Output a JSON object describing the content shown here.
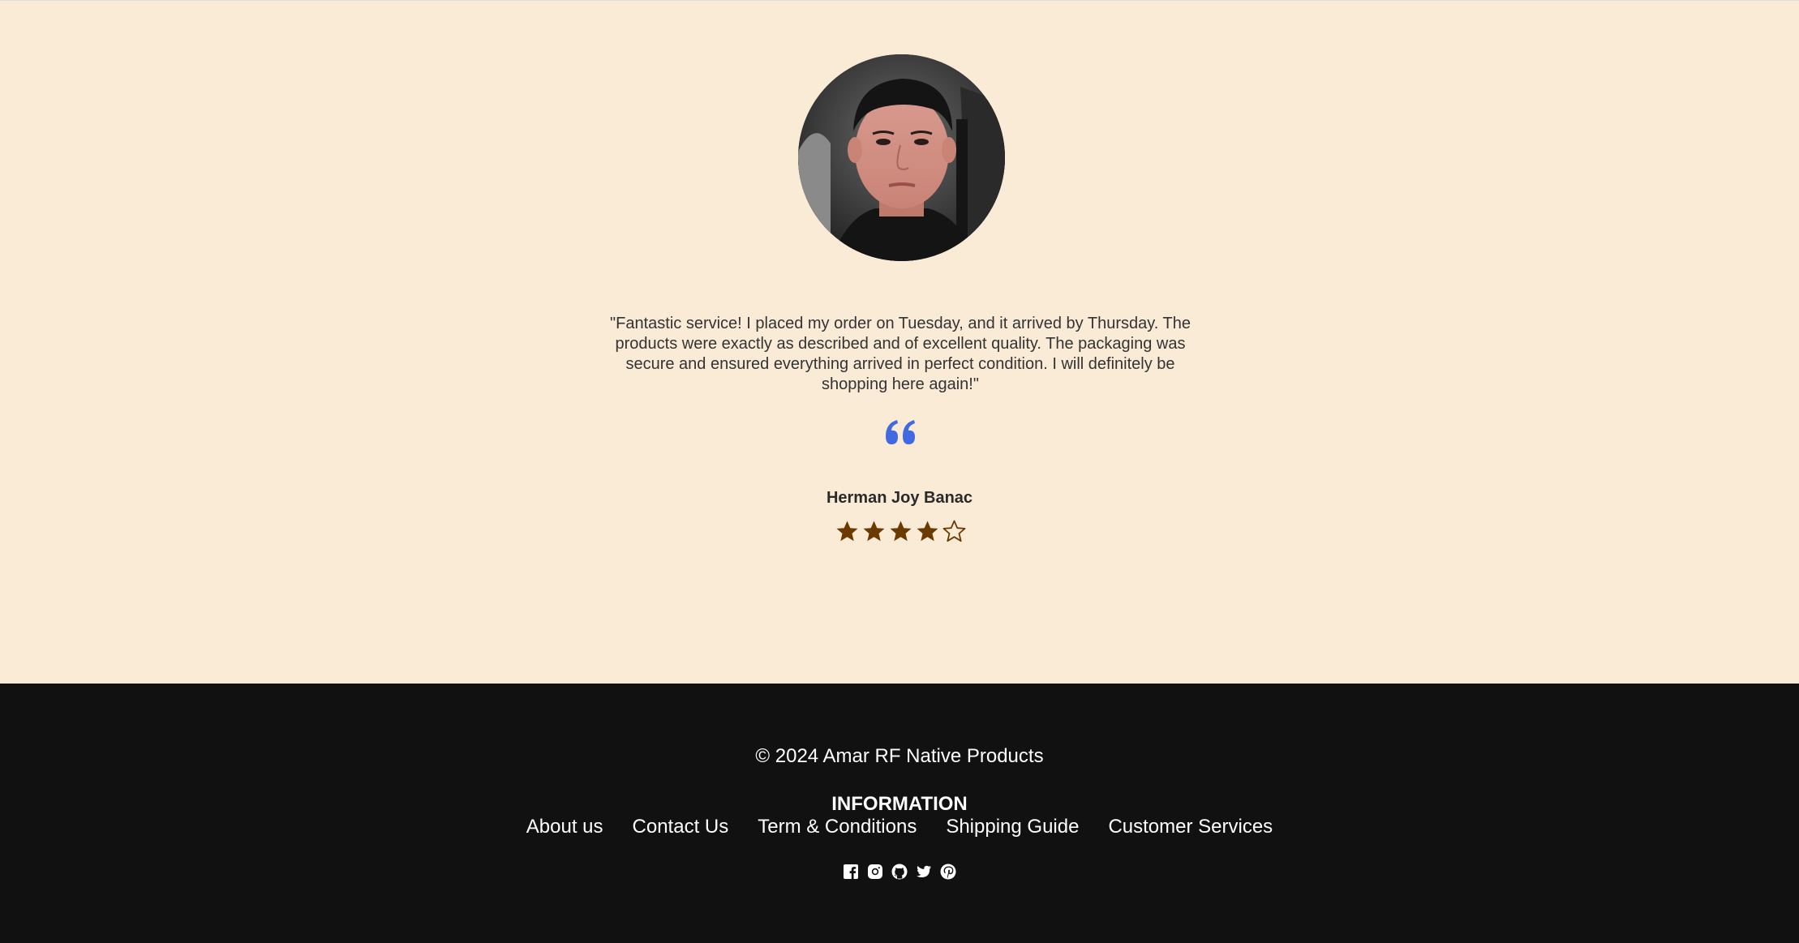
{
  "testimonial": {
    "quote": "\"Fantastic service! I placed my order on Tuesday, and it arrived by Thursday. The products were exactly as described and of excellent quality. The packaging was secure and ensured everything arrived in perfect condition. I will definitely be shopping here again!\"",
    "quote_icon": "quote-left-icon",
    "quote_icon_color": "#4169e1",
    "reviewer_name": "Herman Joy Banac",
    "rating": 4,
    "rating_max": 5,
    "star_color": "#6b3a00",
    "background_color": "#faebd7"
  },
  "footer": {
    "copyright": "© 2024 Amar RF Native Products",
    "info_heading": "INFORMATION",
    "links": [
      {
        "label": "About us"
      },
      {
        "label": "Contact Us"
      },
      {
        "label": "Term & Conditions"
      },
      {
        "label": "Shipping Guide"
      },
      {
        "label": "Customer Services"
      }
    ],
    "social_icons": [
      "facebook-icon",
      "instagram-icon",
      "github-icon",
      "twitter-icon",
      "pinterest-icon"
    ],
    "background_color": "#111111"
  }
}
